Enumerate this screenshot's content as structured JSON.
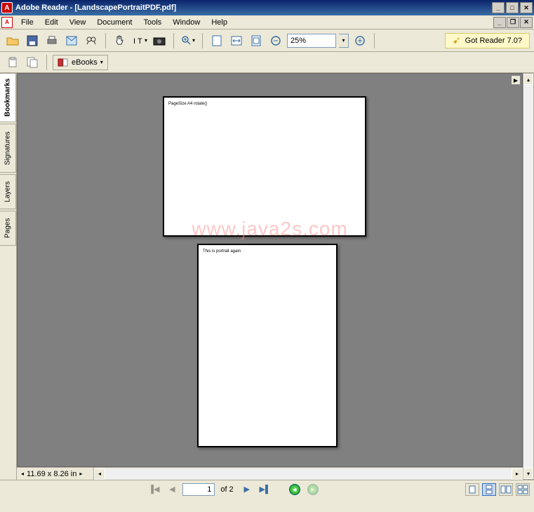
{
  "titlebar": {
    "app": "Adobe Reader",
    "doc": "[LandscapePortraitPDF.pdf]"
  },
  "menu": {
    "file": "File",
    "edit": "Edit",
    "view": "View",
    "document": "Document",
    "tools": "Tools",
    "window": "Window",
    "help": "Help"
  },
  "toolbar": {
    "zoom_value": "25%",
    "promo": "Got Reader 7.0?"
  },
  "toolbar2": {
    "ebooks_label": "eBooks"
  },
  "nav_tabs": {
    "bookmarks": "Bookmarks",
    "signatures": "Signatures",
    "layers": "Layers",
    "pages": "Pages"
  },
  "pages": {
    "p1_text": "PageSize A4 rotate()",
    "p2_text": "This is portrait again"
  },
  "watermark": "www.java2s.com",
  "hscroll": {
    "size_label": "11.69 x 8.26 in"
  },
  "status": {
    "current_page": "1",
    "page_of": "of 2"
  }
}
